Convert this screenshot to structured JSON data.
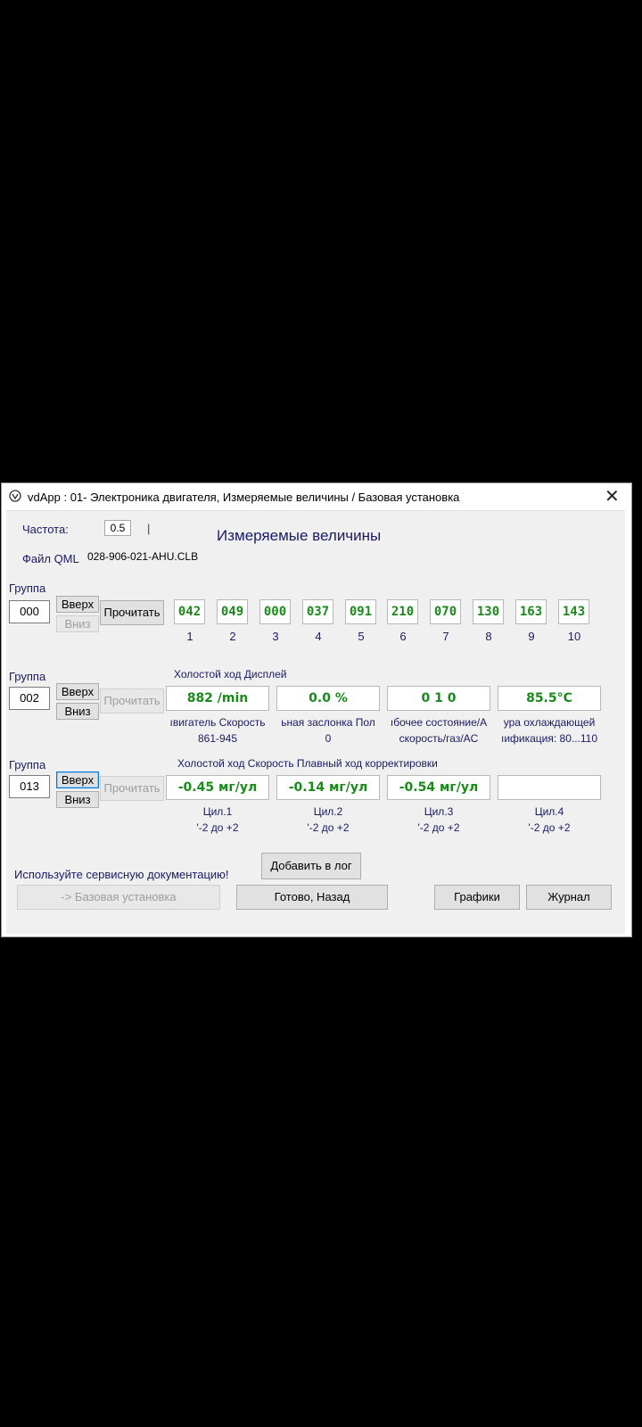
{
  "window": {
    "title": "vdApp : 01- Электроника двигателя,  Измеряемые величины / Базовая установка",
    "close": "✕"
  },
  "header": {
    "freq_label": "Частота:",
    "freq_value": "0.5",
    "freq_marker": "|",
    "file_label": "Файл QML",
    "file_value": "028-906-021-AHU.CLB",
    "title": "Измеряемые величины"
  },
  "group1": {
    "label": "Группа",
    "value": "000",
    "up": "Вверх",
    "down": "Вниз",
    "read": "Прочитать",
    "raw": [
      "042",
      "049",
      "000",
      "037",
      "091",
      "210",
      "070",
      "130",
      "163",
      "143"
    ],
    "nums": [
      "1",
      "2",
      "3",
      "4",
      "5",
      "6",
      "7",
      "8",
      "9",
      "10"
    ]
  },
  "group2": {
    "label": "Группа",
    "value": "002",
    "up": "Вверх",
    "down": "Вниз",
    "read": "Прочитать",
    "caption": "Холостой ход Дисплей",
    "values": [
      "882 /min",
      "0.0 %",
      "0 1 0",
      "85.5°C"
    ],
    "names": [
      "ıвигатель Скорость",
      "ьная заслонка Пол",
      "ıбочее состояние/А",
      "ура охлаждающей"
    ],
    "ranges": [
      "861-945",
      "0",
      "скорость/газ/AC",
      "ıификация: 80...110"
    ]
  },
  "group3": {
    "label": "Группа",
    "value": "013",
    "up": "Вверх",
    "down": "Вниз",
    "read": "Прочитать",
    "caption": "Холостой ход Скорость Плавный ход корректировки",
    "values": [
      "-0.45 мг/ул",
      "-0.14 мг/ул",
      "-0.54 мг/ул",
      ""
    ],
    "names": [
      "Цил.1",
      "Цил.2",
      "Цил.3",
      "Цил.4"
    ],
    "ranges": [
      "'-2 до +2",
      "'-2 до +2",
      "'-2 до +2",
      "'-2 до +2"
    ]
  },
  "footer": {
    "notice": "Используйте сервисную документацию!",
    "add_log": "Добавить в лог",
    "basic": "-> Базовая установка",
    "done": "Готово, Назад",
    "graphs": "Графики",
    "journal": "Журнал"
  }
}
